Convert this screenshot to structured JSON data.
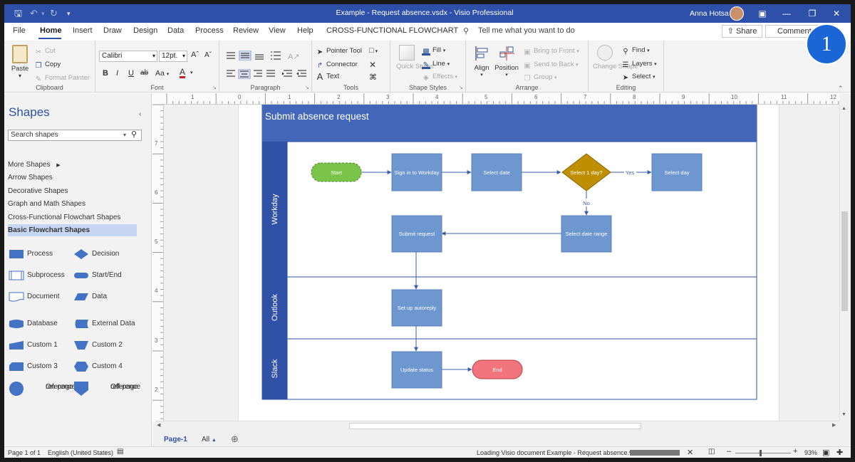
{
  "titlebar": {
    "title": "Example - Request absence.vsdx  -  Visio Professional",
    "user": "Anna Hotsa",
    "icons": [
      "save-icon",
      "undo-icon",
      "redo-icon",
      "customize-icon",
      "ribbon-display-icon",
      "minimize-icon",
      "restore-icon",
      "close-icon"
    ]
  },
  "menu": {
    "tabs": [
      "File",
      "Home",
      "Insert",
      "Draw",
      "Design",
      "Data",
      "Process",
      "Review",
      "View",
      "Help",
      "CROSS-FUNCTIONAL FLOWCHART"
    ],
    "active": "Home",
    "tell_me": "Tell me what you want to do",
    "share": "Share",
    "comments": "Comments"
  },
  "step_badge": "1",
  "ribbon": {
    "clipboard": {
      "label": "Clipboard",
      "paste": "Paste",
      "cut": "Cut",
      "copy": "Copy",
      "format_painter": "Format Painter"
    },
    "font": {
      "label": "Font",
      "family": "Calibri",
      "size": "12pt.",
      "bold": "B",
      "italic": "I",
      "underline": "U",
      "strike": "ab",
      "case": "Aa",
      "color": "A"
    },
    "paragraph": {
      "label": "Paragraph"
    },
    "tools": {
      "label": "Tools",
      "pointer": "Pointer Tool",
      "connector": "Connector",
      "text": "Text"
    },
    "shape_styles": {
      "label": "Shape Styles",
      "quick_styles": "Quick Styles",
      "fill": "Fill",
      "line": "Line",
      "effects": "Effects"
    },
    "arrange": {
      "label": "Arrange",
      "align": "Align",
      "position": "Position",
      "bring_front": "Bring to Front",
      "send_back": "Send to Back",
      "group": "Group"
    },
    "editing": {
      "label": "Editing",
      "change_shape": "Change Shape",
      "find": "Find",
      "layers": "Layers",
      "select": "Select"
    }
  },
  "shapes_panel": {
    "title": "Shapes",
    "search_placeholder": "Search shapes",
    "stencils": [
      "More Shapes",
      "Arrow Shapes",
      "Decorative Shapes",
      "Graph and Math Shapes",
      "Cross-Functional Flowchart Shapes",
      "Basic Flowchart Shapes"
    ],
    "active_stencil": "Basic Flowchart Shapes",
    "masters": [
      {
        "name": "Process",
        "shape": "process"
      },
      {
        "name": "Decision",
        "shape": "decision"
      },
      {
        "name": "Subprocess",
        "shape": "subprocess"
      },
      {
        "name": "Start/End",
        "shape": "startend"
      },
      {
        "name": "Document",
        "shape": "document"
      },
      {
        "name": "Data",
        "shape": "data"
      },
      {
        "name": "Database",
        "shape": "database"
      },
      {
        "name": "External Data",
        "shape": "external"
      },
      {
        "name": "Custom 1",
        "shape": "custom1"
      },
      {
        "name": "Custom 2",
        "shape": "custom2"
      },
      {
        "name": "Custom 3",
        "shape": "custom3"
      },
      {
        "name": "Custom 4",
        "shape": "custom4"
      },
      {
        "name": "On-page reference",
        "line1": "On-page",
        "line2": "reference",
        "shape": "onpage"
      },
      {
        "name": "Off-page reference",
        "line1": "Off-page",
        "line2": "reference",
        "shape": "offpage"
      }
    ]
  },
  "rulers": {
    "horizontal": [
      "1",
      "0",
      "1",
      "2",
      "3",
      "4",
      "5",
      "6",
      "7",
      "8",
      "9",
      "10",
      "11",
      "12"
    ],
    "vertical": [
      "7",
      "6",
      "5",
      "4",
      "3",
      "2"
    ]
  },
  "diagram": {
    "title": "Submit absence request",
    "lanes": [
      "Workday",
      "Outlook",
      "Slack"
    ],
    "shapes": {
      "start": "Start",
      "sign_in": "Sign in to Workday",
      "select_date": "Select date",
      "decision": "Select 1 day?",
      "select_day": "Select day",
      "submit_request": "Submit request",
      "select_range": "Select date range",
      "autoreply": "Set up autoreply",
      "update_status": "Update status",
      "end": "End"
    },
    "labels": {
      "yes": "Yes",
      "no": "No"
    },
    "colors": {
      "header": "#4466b8",
      "lane_band": "#2f52a6",
      "process": "#6e96cf",
      "start": "#7cc349",
      "decision": "#bf8f00",
      "end": "#f2747c"
    }
  },
  "page_tabs": {
    "page": "Page-1",
    "all": "All"
  },
  "status": {
    "page": "Page 1 of 1",
    "language": "English (United States)",
    "loading": "Loading Visio document Example - Request absence.vsdx...",
    "zoom": "93%"
  }
}
